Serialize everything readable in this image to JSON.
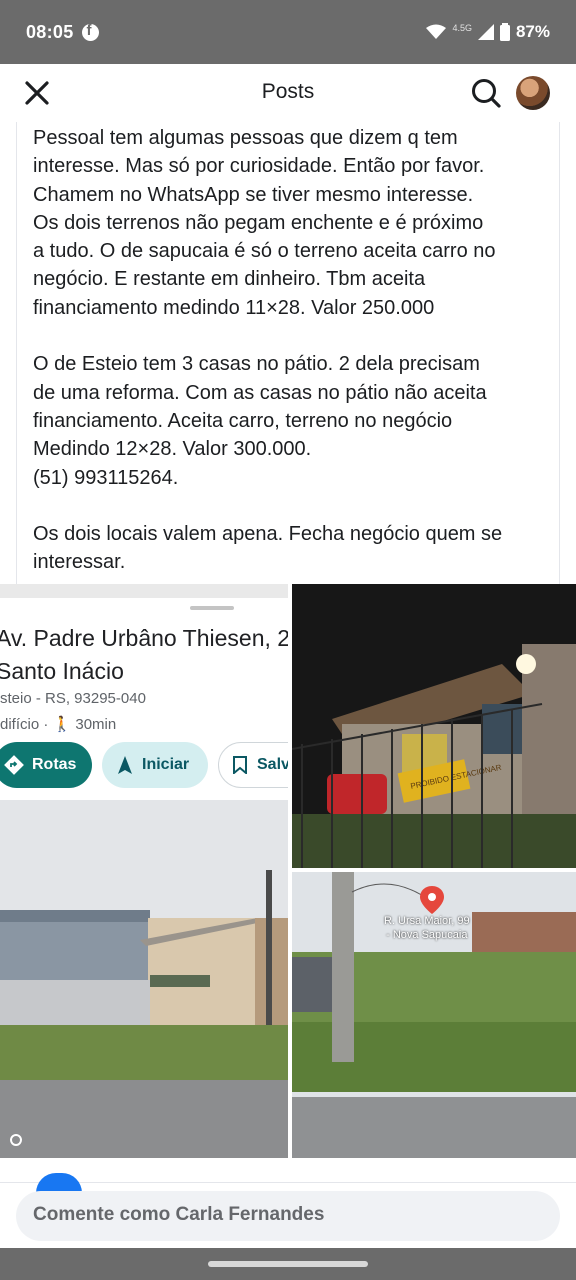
{
  "status_bar": {
    "time": "08:05",
    "network": "4.5G",
    "battery": "87%"
  },
  "header": {
    "title": "Posts"
  },
  "post": {
    "text": "Pessoal tem algumas pessoas que dizem q tem\ninteresse. Mas só por curiosidade. Então por favor.\nChamem no WhatsApp se tiver mesmo interesse.\nOs dois terrenos não pegam enchente e é próximo\na tudo. O de sapucaia é só o terreno aceita carro no\nnegócio. E restante em dinheiro. Tbm aceita\nfinanciamento medindo 11×28.  Valor 250.000\n\nO de Esteio tem 3 casas no pátio. 2 dela precisam\nde uma reforma. Com as casas no pátio não aceita\nfinanciamento. Aceita  carro, terreno no negócio\nMedindo 12×28. Valor 300.000.\n(51) 993115264.\n\nOs dois locais valem apena. Fecha negócio quem se\ninteressar."
  },
  "photos": {
    "maps": {
      "address_line1": "Av. Padre Urbâno Thiesen, 2",
      "address_line2": "Santo Inácio",
      "city": "steio - RS, 93295-040",
      "meta": "difício · 🚶 30min",
      "buttons": {
        "rotas": "Rotas",
        "iniciar": "Iniciar",
        "salvar": "Salv"
      }
    },
    "night": {
      "sign": "PROIBIDO ESTACIONAR"
    },
    "plot": {
      "badge_line1": "R. Ursa Maior, 99",
      "badge_line2": "- Nova Sapucaia"
    }
  },
  "composer": {
    "placeholder": "Comente como Carla Fernandes"
  },
  "colors": {
    "maps_accent": "#0e7670",
    "facebook_blue": "#1877f2"
  }
}
